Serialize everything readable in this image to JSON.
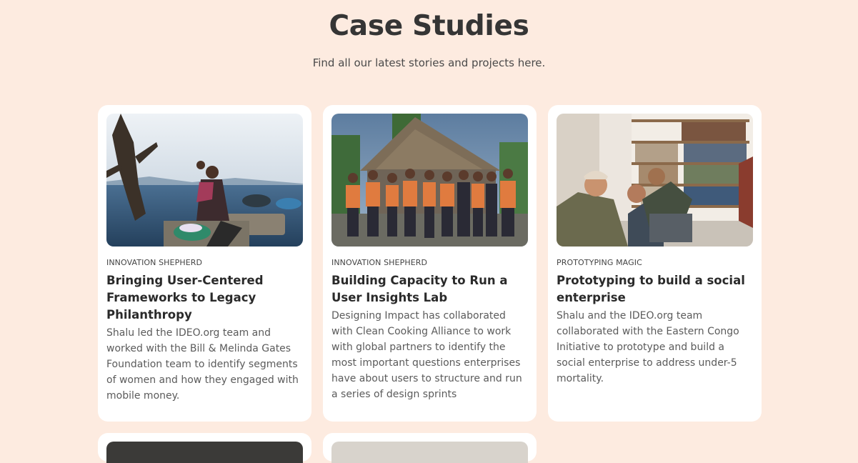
{
  "header": {
    "title": "Case Studies",
    "subtitle": "Find all our latest stories and projects here."
  },
  "cards": [
    {
      "category": "INNOVATION SHEPHERD",
      "title": "Bringing User-Centered Frameworks to Legacy Philanthropy",
      "description": "Shalu led the IDEO.org team and worked with the Bill & Melinda Gates Foundation team to identify segments of women and how they engaged with mobile money.",
      "image": "woman-washing-clothes-at-lake-photo"
    },
    {
      "category": "INNOVATION SHEPHERD",
      "title": "Building Capacity to Run a User Insights Lab",
      "description": "Designing Impact has collaborated with Clean Cooking Alliance to work with global partners to identify the most important questions enterprises have about users to structure and run a series of design sprints",
      "image": "team-in-front-of-thatched-hut-photo"
    },
    {
      "category": "PROTOTYPING MAGIC",
      "title": "Prototyping to build a social enterprise",
      "description": "Shalu and the IDEO.org team collaborated with the Eastern Congo Initiative to prototype and build a social enterprise to address under-5 mortality.",
      "image": "people-around-laptop-in-library-photo"
    }
  ],
  "colors": {
    "page_background": "#fdebe0",
    "card_background": "#ffffff",
    "title_text": "#353535"
  }
}
